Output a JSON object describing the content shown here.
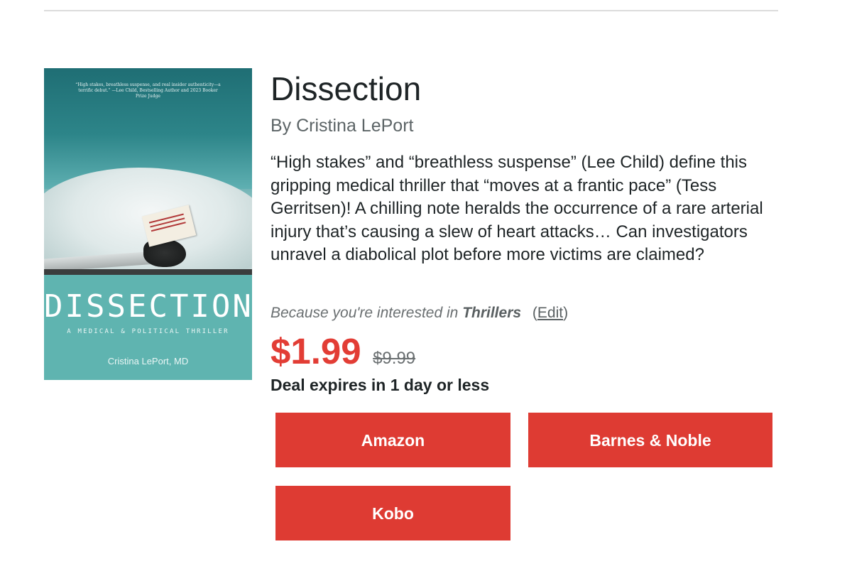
{
  "book": {
    "title": "Dissection",
    "byline": "By Cristina LePort",
    "description": "“High stakes” and “breathless suspense” (Lee Child) define this gripping medical thriller that “moves at a frantic pace” (Tess Gerritsen)! A chilling note heralds the occurrence of a rare arterial injury that’s causing a slew of heart attacks… Can investigators unravel a diabolical plot before more victims are claimed?"
  },
  "cover": {
    "quote": "“High stakes, breathless suspense, and real insider authenticity—a terrific debut.” —Lee Child, Bestselling Author and 2023 Booker Prize Judge",
    "title": "DISSECTION",
    "subtitle": "A MEDICAL & POLITICAL THRILLER",
    "author": "Cristina LePort, MD",
    "colors": {
      "lower_panel": "#5fb4b0",
      "title_text": "#ffffff"
    }
  },
  "interest": {
    "prefix": "Because you're interested in",
    "genre": "Thrillers",
    "edit_open": "(",
    "edit_label": "Edit",
    "edit_close": ")"
  },
  "pricing": {
    "price": "$1.99",
    "original_price": "$9.99",
    "deal_text": "Deal expires in 1 day or less",
    "price_color": "#e23d35"
  },
  "stores": {
    "button_color": "#de3b33",
    "amazon": "Amazon",
    "barnes_noble": "Barnes & Noble",
    "kobo": "Kobo"
  }
}
